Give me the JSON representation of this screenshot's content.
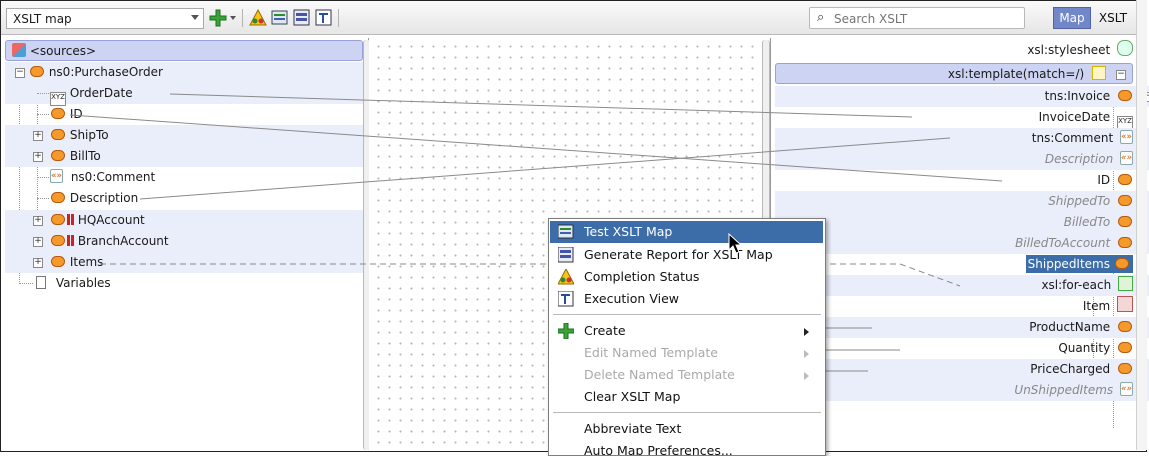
{
  "toolbar": {
    "view_select": "XSLT map",
    "search_placeholder": "Search XSLT",
    "mode_map": "Map",
    "mode_xslt": "XSLT"
  },
  "sources": {
    "root": "<sources>",
    "items": [
      {
        "label": "ns0:PurchaseOrder"
      },
      {
        "label": "OrderDate"
      },
      {
        "label": "ID"
      },
      {
        "label": "ShipTo"
      },
      {
        "label": "BillTo"
      },
      {
        "label": "ns0:Comment"
      },
      {
        "label": "Description"
      },
      {
        "label": "HQAccount"
      },
      {
        "label": "BranchAccount"
      },
      {
        "label": "Items"
      },
      {
        "label": "Variables"
      }
    ]
  },
  "target": {
    "items": [
      {
        "label": "xsl:stylesheet"
      },
      {
        "label": "xsl:template(match=/)"
      },
      {
        "label": "tns:Invoice"
      },
      {
        "label": "InvoiceDate"
      },
      {
        "label": "tns:Comment"
      },
      {
        "label": "Description"
      },
      {
        "label": "ID"
      },
      {
        "label": "ShippedTo"
      },
      {
        "label": "BilledTo"
      },
      {
        "label": "BilledToAccount"
      },
      {
        "label": "ShippedItems"
      },
      {
        "label": "xsl:for-each"
      },
      {
        "label": "Item"
      },
      {
        "label": "ProductName"
      },
      {
        "label": "Quantity"
      },
      {
        "label": "PriceCharged"
      },
      {
        "label": "UnShippedItems"
      }
    ]
  },
  "context_menu": {
    "items": [
      {
        "label": "Test XSLT Map",
        "state": "highlighted"
      },
      {
        "label": "Generate Report for XSLT Map"
      },
      {
        "label": "Completion Status"
      },
      {
        "label": "Execution View"
      },
      {
        "label": "Create"
      },
      {
        "label": "Edit Named Template",
        "state": "disabled"
      },
      {
        "label": "Delete Named Template",
        "state": "disabled"
      },
      {
        "label": "Clear XSLT Map"
      },
      {
        "label": "Abbreviate Text"
      },
      {
        "label": "Auto Map Preferences..."
      }
    ]
  },
  "colors": {
    "accent": "#3d6da8",
    "map_button": "#7287c8",
    "row_band": "#eaedfa",
    "element_icon": "#f59a2a"
  }
}
